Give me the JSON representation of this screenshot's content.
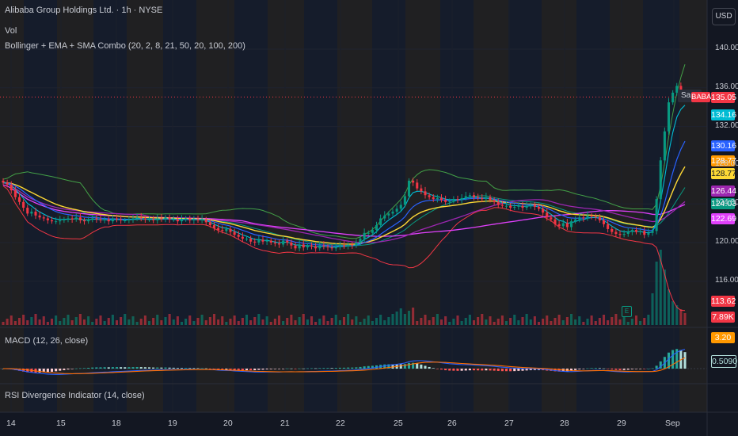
{
  "header": {
    "title": "Alibaba Group Holdings Ltd. · 1h · NYSE",
    "vol": "Vol",
    "indicator": "Bollinger + EMA + SMA Combo (20, 2, 8, 21, 50, 20, 100, 200)",
    "currency": "USD"
  },
  "macd": {
    "label": "MACD (12, 26, close)"
  },
  "rsi": {
    "label": "RSI Divergence Indicator (14, close)"
  },
  "markers": {
    "symbol": "BABA",
    "same": "Sam",
    "earnings": "E"
  },
  "price_axis": {
    "ticks": [
      "140.00",
      "136.00",
      "132.00",
      "128.00",
      "124.00",
      "120.00",
      "116.00"
    ]
  },
  "time_axis": {
    "ticks": [
      "14",
      "15",
      "18",
      "19",
      "20",
      "21",
      "22",
      "25",
      "26",
      "27",
      "28",
      "29",
      "Sep"
    ]
  },
  "badges": [
    {
      "value": "135.05",
      "color": "#f23645"
    },
    {
      "value": "134.16",
      "color": "#00bcd4"
    },
    {
      "value": "130.16",
      "color": "#2962ff"
    },
    {
      "value": "128.77",
      "color": "#ff9800"
    },
    {
      "value": "128.77",
      "color": "#fdd835",
      "dark": true
    },
    {
      "value": "126.44",
      "color": "#9c27b0"
    },
    {
      "value": "124.03",
      "color": "#089981"
    },
    {
      "value": "122.69",
      "color": "#e040fb"
    },
    {
      "value": "113.62",
      "color": "#f23645"
    },
    {
      "value": "7.89K",
      "color": "#f23645"
    },
    {
      "value": "3.20",
      "color": "#ff9800"
    },
    {
      "value": "0.5090",
      "color": "#131722",
      "border": "#b2dfdb",
      "text": "#b2dfdb"
    }
  ],
  "colors": {
    "bb_basis": "#089981",
    "bb_upper": "#43a047",
    "bb_lower": "#f23645",
    "ema8": "#00bcd4",
    "ema21": "#2962ff",
    "ema50": "#fdd835",
    "sma100": "#9c27b0",
    "sma200": "#e040fb",
    "up": "#089981",
    "down": "#f23645",
    "macd": "#2962ff",
    "signal": "#ff6d00"
  },
  "chart_data": {
    "type": "candlestick",
    "symbol": "BABA",
    "interval": "1h",
    "y_axis_ticks": [
      140,
      136,
      132,
      128,
      124,
      120,
      116
    ],
    "last_price": 135.05,
    "closes": [
      126.2,
      126,
      125.4,
      124.7,
      124.2,
      123.6,
      123,
      123.2,
      122.8,
      122.6,
      122.5,
      122.3,
      122.2,
      122.2,
      122.3,
      122.4,
      122.5,
      122.4,
      122.6,
      122.3,
      122.2,
      122.4,
      122.5,
      122.4,
      122.3,
      122.4,
      122.2,
      122.5,
      122.4,
      122.3,
      122.3,
      122.4,
      122.5,
      122.6,
      122.5,
      122.4,
      122.4,
      122.3,
      122.5,
      122.4,
      122.6,
      122.4,
      122.4,
      122.2,
      122.4,
      122.5,
      122.3,
      122.4,
      122.3,
      122.4,
      122.1,
      121.8,
      121.5,
      121.3,
      121.2,
      121.4,
      121.1,
      120.8,
      120.6,
      120.4,
      120.4,
      120.1,
      120,
      120.3,
      120.1,
      120.2,
      120,
      119.9,
      119.8,
      120.2,
      120,
      119.7,
      119.4,
      119.8,
      119.5,
      119.7,
      119.6,
      119.4,
      119.7,
      119.6,
      119.5,
      119.4,
      119.6,
      119.7,
      119.6,
      119.8,
      119.7,
      120,
      120.4,
      121,
      121,
      121.3,
      121.8,
      122.5,
      122.8,
      123,
      123.2,
      123.5,
      123.9,
      124.8,
      126.4,
      126.2,
      125.6,
      125.3,
      124.9,
      124.7,
      124.5,
      124.6,
      124.4,
      124.2,
      124.3,
      124.5,
      124.4,
      124.6,
      124.8,
      124.9,
      124.7,
      124.6,
      124.5,
      124.7,
      124.4,
      124.2,
      123.9,
      123.8,
      123.8,
      123.6,
      123.7,
      123.8,
      123.6,
      123.8,
      123.9,
      123.7,
      123.5,
      123.1,
      122.6,
      122.4,
      121.9,
      121.7,
      122,
      121.6,
      122.2,
      122.4,
      122.6,
      122.5,
      122.8,
      122.7,
      122.6,
      122.3,
      121.9,
      121.4,
      121.1,
      120.9,
      120.8,
      120.9,
      121.1,
      121.3,
      121.1,
      121.2,
      120.8,
      121,
      121.2,
      124.5,
      128.5,
      131.5,
      134.5,
      135.5,
      136.2,
      135.4,
      135.05
    ],
    "volume_bars": 169,
    "notes": "Hourly candlesticks with Bollinger Bands (20,2), EMA 8/21/50, SMA 100/200, volume, and MACD (12,26) histogram."
  }
}
